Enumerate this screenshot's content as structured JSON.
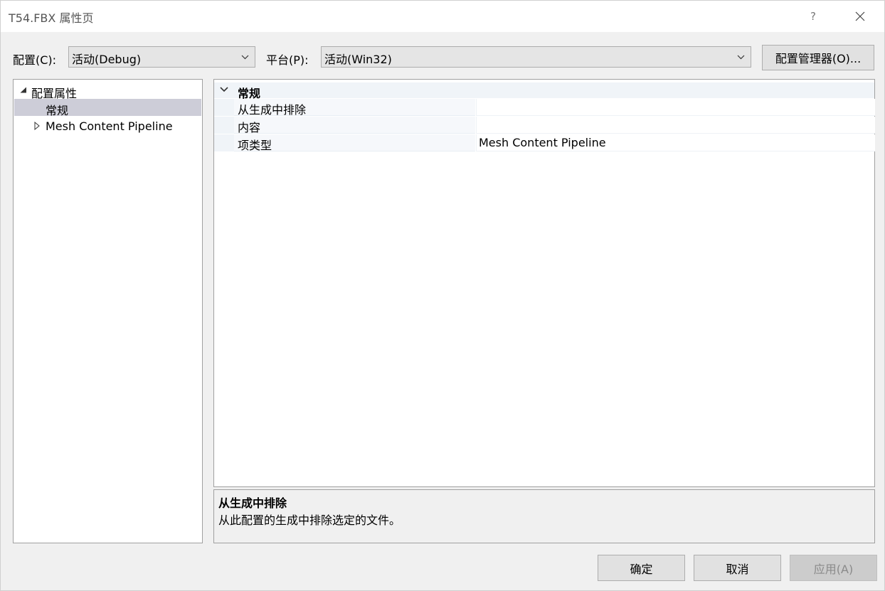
{
  "window": {
    "title": "T54.FBX 属性页",
    "help_label": "?"
  },
  "toolbar": {
    "config_label": "配置(C):",
    "config_value": "活动(Debug)",
    "platform_label": "平台(P):",
    "platform_value": "活动(Win32)",
    "config_manager_label": "配置管理器(O)..."
  },
  "tree": {
    "items": [
      {
        "label": "配置属性"
      },
      {
        "label": "常规"
      },
      {
        "label": "Mesh Content Pipeline"
      }
    ]
  },
  "grid": {
    "category": "常规",
    "rows": [
      {
        "name": "从生成中排除",
        "value": ""
      },
      {
        "name": "内容",
        "value": ""
      },
      {
        "name": "项类型",
        "value": "Mesh Content Pipeline"
      }
    ]
  },
  "description": {
    "title": "从生成中排除",
    "text": "从此配置的生成中排除选定的文件。"
  },
  "buttons": {
    "ok": "确定",
    "cancel": "取消",
    "apply": "应用(A)"
  }
}
